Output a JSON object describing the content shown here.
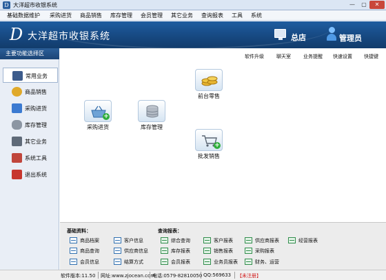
{
  "window": {
    "title": "大洋超市收银系统",
    "controls": [
      "—",
      "▢",
      "✕"
    ]
  },
  "menu": [
    "基础数据维护",
    "采购进货",
    "商品销售",
    "库存管理",
    "会员管理",
    "其它业务",
    "查询报表",
    "工具",
    "系统"
  ],
  "banner": {
    "app_name": "大洋超市收银系统",
    "store_label": "总店",
    "user_label": "管理员"
  },
  "sidebar": {
    "header": "主要功能选择区",
    "items": [
      {
        "label": "常用业务",
        "icon": "book-icon",
        "active": true
      },
      {
        "label": "商品销售",
        "icon": "coins-icon",
        "active": false
      },
      {
        "label": "采购进货",
        "icon": "truck-icon",
        "active": false
      },
      {
        "label": "库存管理",
        "icon": "database-icon",
        "active": false
      },
      {
        "label": "其它业务",
        "icon": "keyboard-icon",
        "active": false
      },
      {
        "label": "系统工具",
        "icon": "tools-icon",
        "active": false
      },
      {
        "label": "退出系统",
        "icon": "exit-icon",
        "active": false
      }
    ]
  },
  "quick_links": [
    "软件升级",
    "聊天室",
    "业务提醒",
    "快速设置",
    "快捷键"
  ],
  "tiles": [
    {
      "label": "采购进货",
      "icon": "basket-add-icon"
    },
    {
      "label": "库存管理",
      "icon": "database-icon"
    },
    {
      "label": "前台零售",
      "icon": "coins-icon"
    },
    {
      "label": "批发销售",
      "icon": "cart-add-icon"
    }
  ],
  "bottom": {
    "basic_title": "基础资料：",
    "basic_items": [
      "商品档案",
      "客户信息",
      "商品查询",
      "供应商信息",
      "会员信息",
      "结算方式"
    ],
    "report_title": "查询报表：",
    "report_items": [
      "综合查询",
      "客户报表",
      "供应商报表",
      "经营报表",
      "库存报表",
      "销售报表",
      "采购报表",
      "会员报表",
      "业务员报表",
      "财务、运营"
    ]
  },
  "status": {
    "version": "软件版本:11.50",
    "website": "网址:www.zjocean.com",
    "phone": "电话:0579-82810050",
    "qq": "QQ:569633",
    "registration": "【未注册】",
    "registration_color": "#d01818"
  }
}
